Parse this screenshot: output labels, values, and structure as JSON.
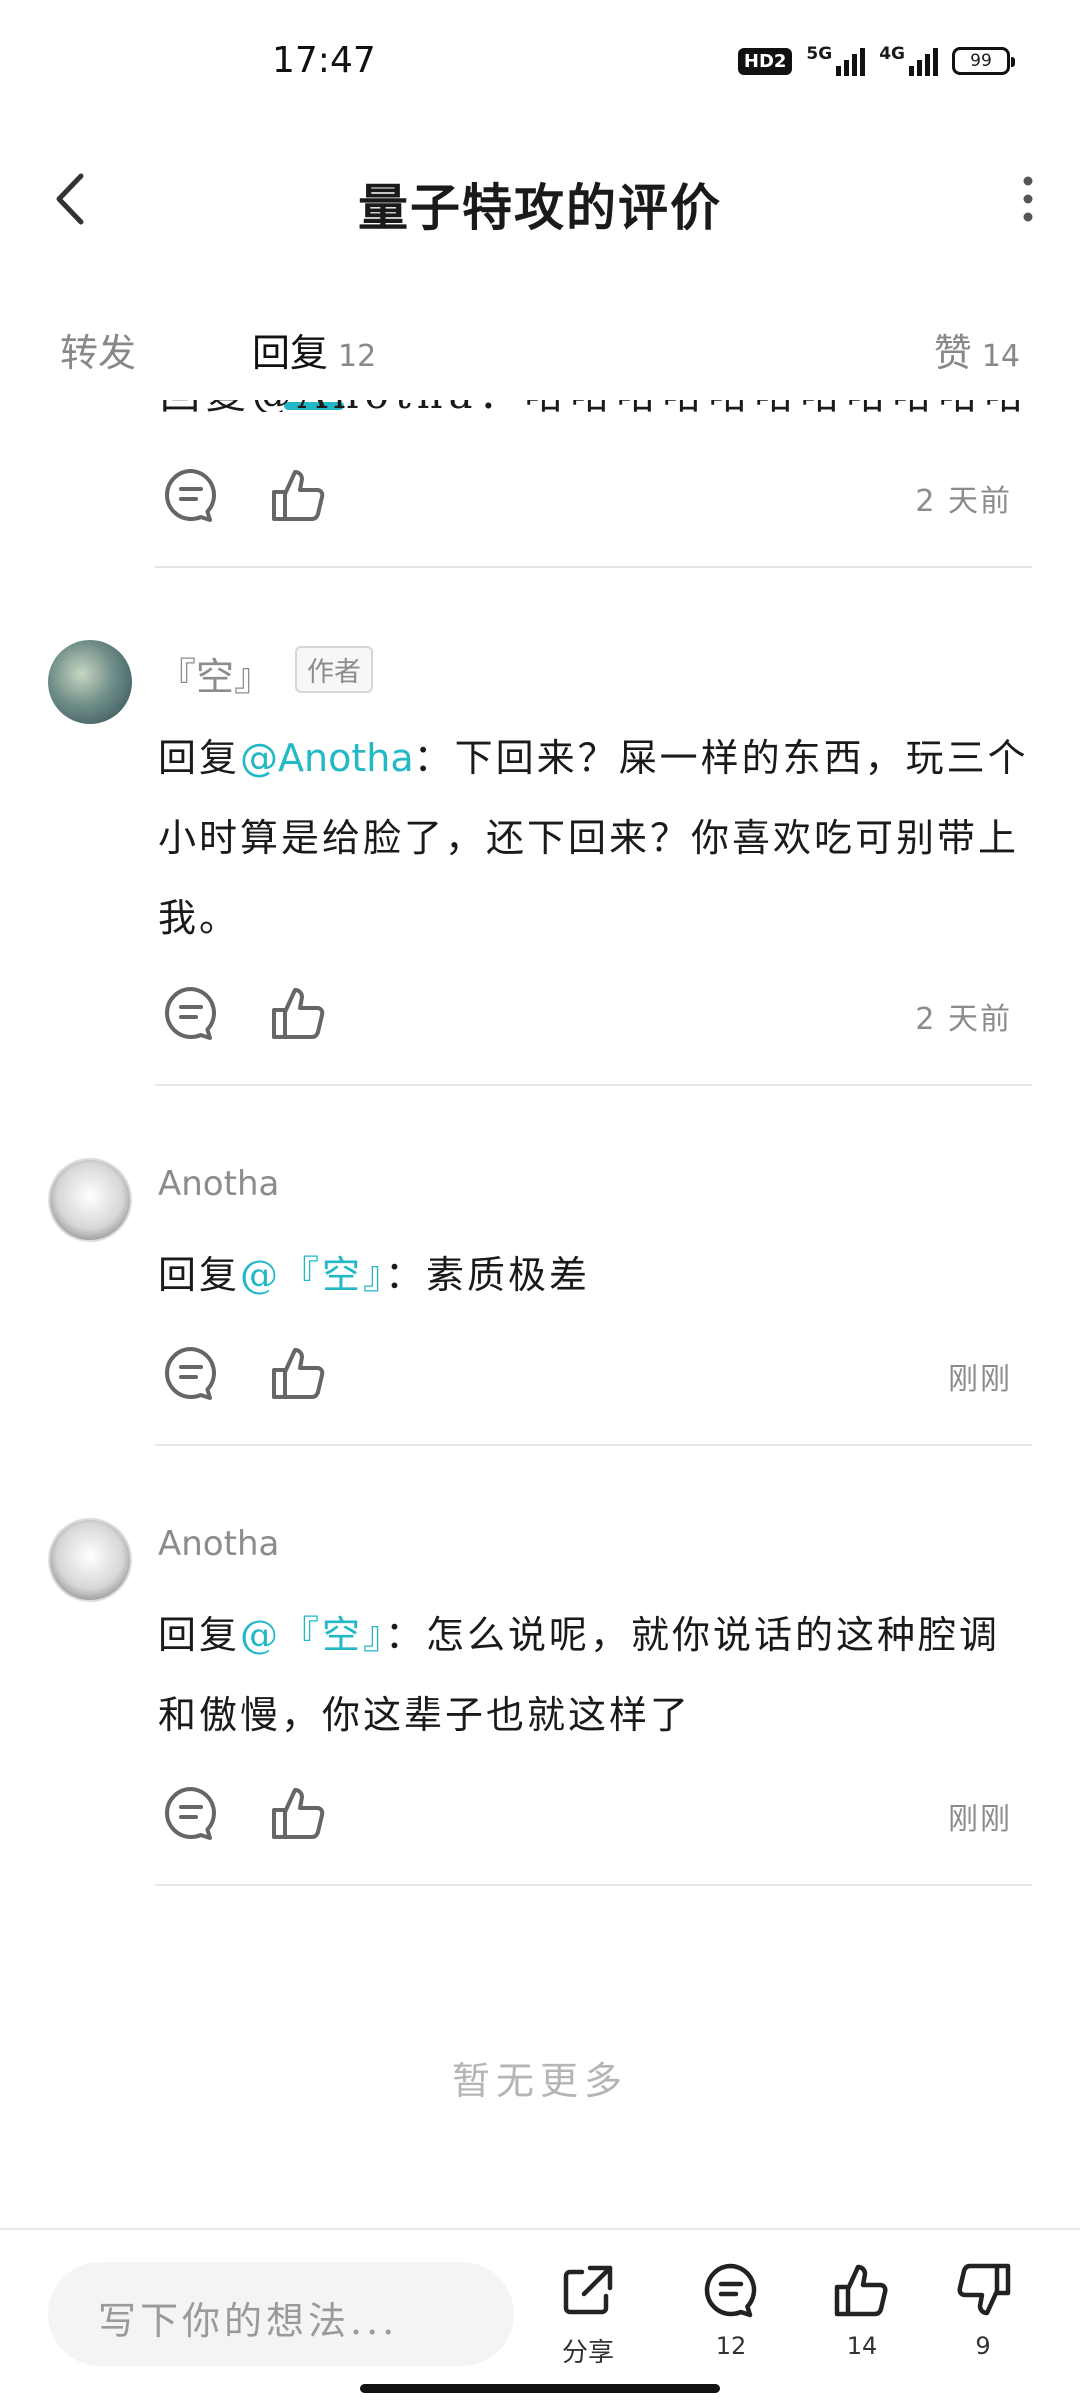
{
  "status_bar": {
    "time": "17:47",
    "hd": "HD2",
    "network1": "5G",
    "network2": "4G",
    "battery": "99"
  },
  "header": {
    "title": "量子特攻的评价"
  },
  "tabs": {
    "forward": {
      "label": "转发"
    },
    "reply": {
      "label": "回复",
      "count": "12"
    },
    "like": {
      "label": "赞",
      "count": "14"
    }
  },
  "feed": {
    "partial_line": "回复@Anotha：哈哈哈哈哈哈哈哈哈哈哈哈",
    "first_time": "2 天前",
    "comments": [
      {
        "author": "『空』",
        "badge": "作者",
        "reply_prefix": "回复",
        "mention": "@Anotha",
        "text": "：下回来？屎一样的东西，玩三个小时算是给脸了，还下回来？你喜欢吃可别带上我。",
        "time": "2 天前"
      },
      {
        "author": "Anotha",
        "reply_prefix": "回复",
        "mention": "@『空』",
        "text": "：素质极差",
        "time": "刚刚"
      },
      {
        "author": "Anotha",
        "reply_prefix": "回复",
        "mention": "@『空』",
        "text": "：怎么说呢，就你说话的这种腔调和傲慢，你这辈子也就这样了",
        "time": "刚刚"
      }
    ],
    "no_more": "暂无更多"
  },
  "bottom_bar": {
    "input_placeholder": "写下你的想法...",
    "share_label": "分享",
    "comment_count": "12",
    "like_count": "14",
    "dislike_count": "9"
  },
  "colors": {
    "accent": "#22b8c6",
    "muted_text": "#8c8c8c",
    "divider": "#e4e4e4"
  }
}
